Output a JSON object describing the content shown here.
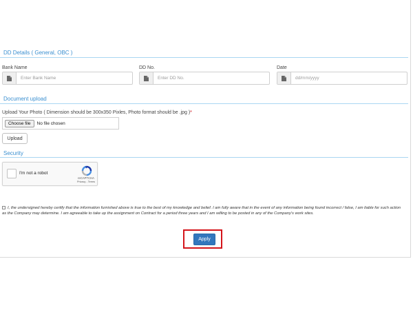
{
  "dd_section": {
    "title": "DD Details ( General, OBC )",
    "bank_name": {
      "label": "Bank Name",
      "placeholder": "Enter Bank Name",
      "value": ""
    },
    "dd_no": {
      "label": "DD No.",
      "placeholder": "Enter DD No.",
      "value": ""
    },
    "date": {
      "label": "Date",
      "placeholder": "dd/mm/yyyy",
      "value": ""
    }
  },
  "upload_section": {
    "title": "Document upload",
    "photo_label": "Upload Your Photo ( Dimension should be 300x350 Pixles, Photo format should be .jpg )",
    "required_mark": "*",
    "choose_file_label": "Choose file",
    "file_status": "No file chosen",
    "upload_label": "Upload"
  },
  "security_section": {
    "title": "Security",
    "captcha_label": "I'm not a robot",
    "captcha_brand": "reCAPTCHA",
    "captcha_links": "Privacy - Terms"
  },
  "declaration": {
    "checked": false,
    "text": "I, the undersigned hereby certify that the information furnished above is true to the best of my knowledge and belief. I am fully aware that in the event of any information being found incorrect / false, I am liable for such action as the Company may determine. I am agreeable to take up the assignment on Contract for a period three years and I am willing to be posted in any of the Company's work sites."
  },
  "apply": {
    "label": "Apply"
  },
  "colors": {
    "accent": "#3a8fd0",
    "apply_button": "#3377bd",
    "highlight": "#d4141a",
    "required": "#d4141a"
  },
  "icons": {
    "input_addon": "file-icon",
    "captcha": "recaptcha-logo-icon"
  }
}
